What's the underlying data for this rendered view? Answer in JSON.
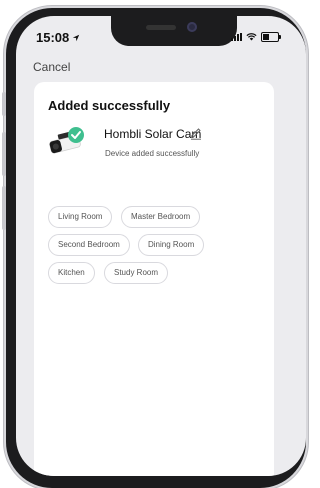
{
  "status_bar": {
    "time": "15:08"
  },
  "nav": {
    "cancel_label": "Cancel"
  },
  "card": {
    "title": "Added successfully",
    "device": {
      "name": "Hombli Solar Cam",
      "status_text": "Device added successfully"
    },
    "rooms": [
      {
        "label": "Living Room"
      },
      {
        "label": "Master Bedroom"
      },
      {
        "label": "Second Bedroom"
      },
      {
        "label": "Dining Room"
      },
      {
        "label": "Kitchen"
      },
      {
        "label": "Study Room"
      }
    ]
  },
  "colors": {
    "success_green": "#3fbf8f",
    "chip_border": "#d9d9de",
    "background": "#ececef"
  },
  "icons": [
    "location-arrow-icon",
    "signal-icon",
    "wifi-icon",
    "battery-icon",
    "check-badge-icon",
    "edit-pencil-icon"
  ]
}
